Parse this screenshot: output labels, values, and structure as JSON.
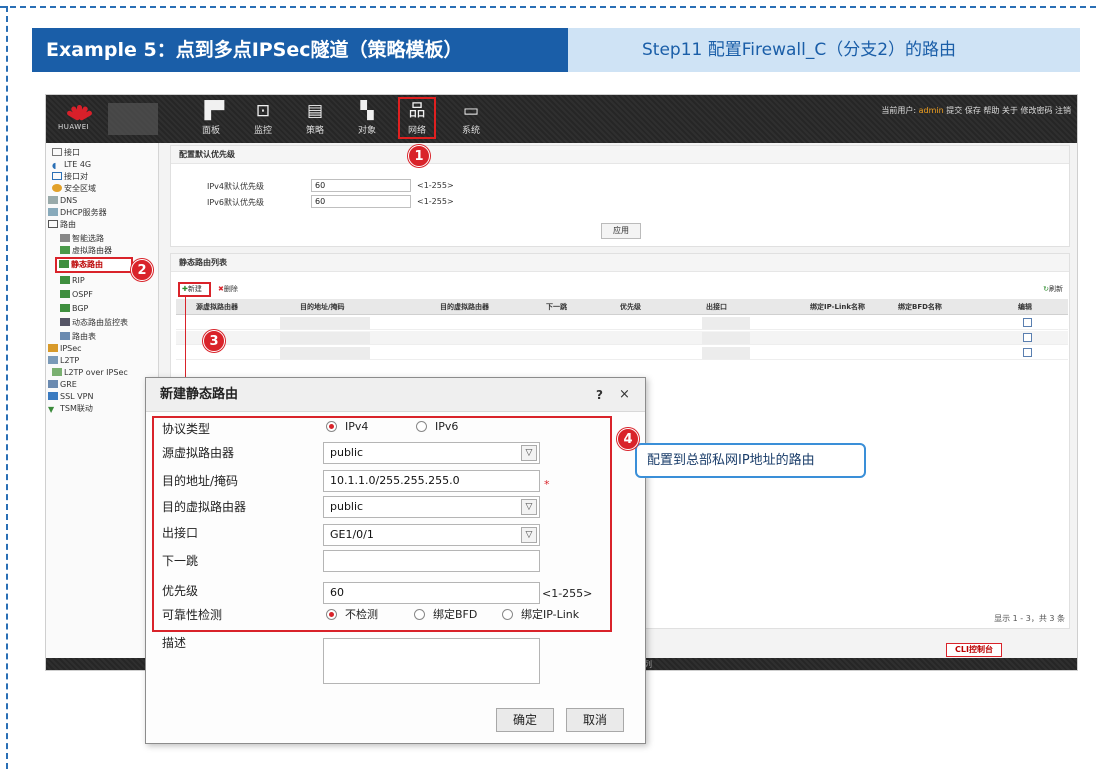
{
  "banner": {
    "title": "Example 5：点到多点IPSec隧道（策略模板）",
    "step": "Step11 配置Firewall_C（分支2）的路由"
  },
  "header": {
    "logo_text": "HUAWEI",
    "nav": [
      {
        "label": "面板",
        "icon": "dashboard-icon"
      },
      {
        "label": "监控",
        "icon": "monitor-icon"
      },
      {
        "label": "策略",
        "icon": "policy-icon"
      },
      {
        "label": "对象",
        "icon": "object-icon"
      },
      {
        "label": "网络",
        "icon": "network-icon"
      },
      {
        "label": "系统",
        "icon": "system-icon"
      }
    ],
    "user_prefix": "当前用户:",
    "user_name": "admin",
    "user_links": "提交  保存  帮助  关于  修改密码  注销"
  },
  "sidebar": {
    "items": [
      "接口",
      "LTE 4G",
      "接口对",
      "安全区域",
      "DNS",
      "DHCP服务器",
      "路由",
      "智能选路",
      "虚拟路由器",
      "静态路由",
      "RIP",
      "OSPF",
      "BGP",
      "动态路由监控表",
      "路由表",
      "IPSec",
      "L2TP",
      "L2TP over IPSec",
      "GRE",
      "SSL VPN",
      "TSM联动"
    ]
  },
  "priority_panel": {
    "title": "配置默认优先级",
    "ipv4_label": "IPv4默认优先级",
    "ipv4_value": "60",
    "ipv6_label": "IPv6默认优先级",
    "ipv6_value": "60",
    "range": "<1-255>",
    "apply": "应用"
  },
  "route_list": {
    "title": "静态路由列表",
    "new": "新建",
    "delete": "删除",
    "refresh": "刷新",
    "columns": [
      "源虚拟路由器",
      "目的地址/掩码",
      "目的虚拟路由器",
      "下一跳",
      "优先级",
      "出接口",
      "绑定IP-Link名称",
      "绑定BFD名称",
      "编辑"
    ],
    "pager": "显示 1 - 3，共 3 条",
    "cli": "CLI控制台"
  },
  "callouts": [
    "1",
    "2",
    "3",
    "4"
  ],
  "dialog": {
    "title": "新建静态路由",
    "help": "?",
    "close": "×",
    "protocol_label": "协议类型",
    "protocol_ipv4": "IPv4",
    "protocol_ipv6": "IPv6",
    "src_vr_label": "源虚拟路由器",
    "src_vr_value": "public",
    "dest_label": "目的地址/掩码",
    "dest_value": "10.1.1.0/255.255.255.0",
    "required_mark": "*",
    "dest_vr_label": "目的虚拟路由器",
    "dest_vr_value": "public",
    "out_if_label": "出接口",
    "out_if_value": "GE1/0/1",
    "next_hop_label": "下一跳",
    "next_hop_value": "",
    "priority_label": "优先级",
    "priority_value": "60",
    "priority_range": "<1-255>",
    "reliability_label": "可靠性检测",
    "reliability_none": "不检测",
    "reliability_bfd": "绑定BFD",
    "reliability_iplink": "绑定IP-Link",
    "desc_label": "描述",
    "ok": "确定",
    "cancel": "取消"
  },
  "note": "配置到总部私网IP地址的路由",
  "colors": {
    "banner_dark": "#1a5ea8",
    "banner_light": "#cfe3f5",
    "highlight_red": "#d9232a",
    "note_border": "#3a8fd8"
  }
}
